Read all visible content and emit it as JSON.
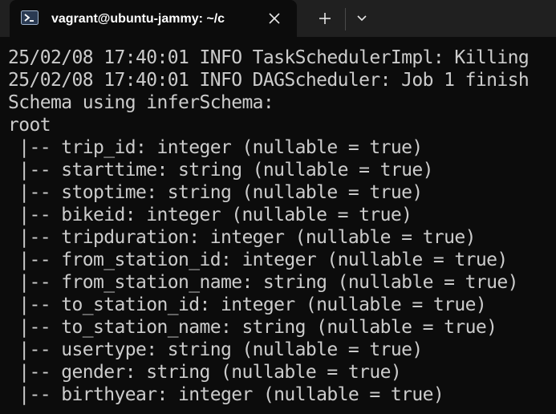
{
  "tab": {
    "icon": "powershell-icon",
    "title": "vagrant@ubuntu-jammy: ~/c",
    "close_icon": "close-icon"
  },
  "toolbar": {
    "new_tab_icon": "plus-icon",
    "dropdown_icon": "chevron-down-icon"
  },
  "terminal": {
    "lines": [
      "25/02/08 17:40:01 INFO TaskSchedulerImpl: Killing",
      "25/02/08 17:40:01 INFO DAGScheduler: Job 1 finish",
      "Schema using inferSchema:",
      "root",
      " |-- trip_id: integer (nullable = true)",
      " |-- starttime: string (nullable = true)",
      " |-- stoptime: string (nullable = true)",
      " |-- bikeid: integer (nullable = true)",
      " |-- tripduration: integer (nullable = true)",
      " |-- from_station_id: integer (nullable = true)",
      " |-- from_station_name: string (nullable = true)",
      " |-- to_station_id: integer (nullable = true)",
      " |-- to_station_name: string (nullable = true)",
      " |-- usertype: string (nullable = true)",
      " |-- gender: string (nullable = true)",
      " |-- birthyear: integer (nullable = true)"
    ]
  },
  "colors": {
    "background": "#0c0c0c",
    "tabbar": "#202020",
    "text": "#cccccc",
    "title": "#ffffff"
  }
}
